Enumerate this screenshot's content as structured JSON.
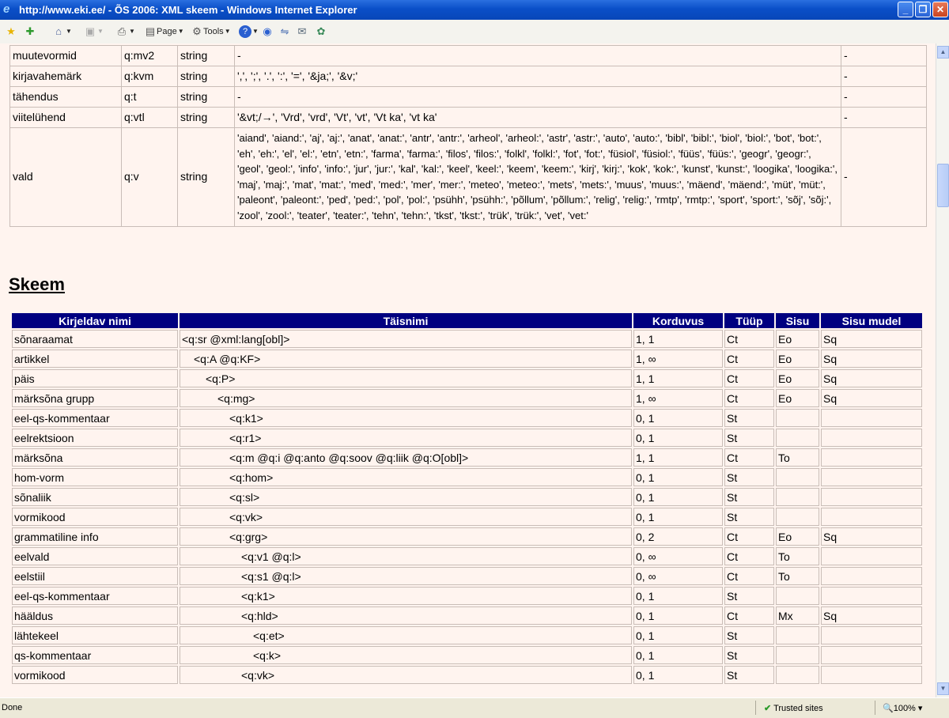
{
  "window": {
    "title": "http://www.eki.ee/ - ÕS 2006: XML skeem - Windows Internet Explorer",
    "minimize_icon": "minimize-icon",
    "maximize_icon": "restore-icon",
    "close_icon": "close-icon"
  },
  "toolbar": {
    "page_label": "Page",
    "tools_label": "Tools"
  },
  "attributes": [
    {
      "name": "muutevormid",
      "code": "q:mv2",
      "type": "string",
      "values": "-",
      "extra": "-"
    },
    {
      "name": "kirjavahemärk",
      "code": "q:kvm",
      "type": "string",
      "values": "',', ';', '.', ':', '=', '&ja;', '&v;'",
      "extra": "-"
    },
    {
      "name": "tähendus",
      "code": "q:t",
      "type": "string",
      "values": "-",
      "extra": "-"
    },
    {
      "name": "viitelühend",
      "code": "q:vtl",
      "type": "string",
      "values": "'&vt;/→', 'Vrd', 'vrd', 'Vt', 'vt', 'Vt ka', 'vt ka'",
      "extra": "-"
    },
    {
      "name": "vald",
      "code": "q:v",
      "type": "string",
      "values": "'aiand', 'aiand:', 'aj', 'aj:', 'anat', 'anat:', 'antr', 'antr:', 'arheol', 'arheol:', 'astr', 'astr:', 'auto', 'auto:', 'bibl', 'bibl:', 'biol', 'biol:', 'bot', 'bot:', 'eh', 'eh:', 'el', 'el:', 'etn', 'etn:', 'farma', 'farma:', 'filos', 'filos:', 'folkl', 'folkl:', 'fot', 'fot:', 'füsiol', 'füsiol:', 'füüs', 'füüs:', 'geogr', 'geogr:', 'geol', 'geol:', 'info', 'info:', 'jur', 'jur:', 'kal', 'kal:', 'keel', 'keel:', 'keem', 'keem:', 'kirj', 'kirj:', 'kok', 'kok:', 'kunst', 'kunst:', 'loogika', 'loogika:', 'maj', 'maj:', 'mat', 'mat:', 'med', 'med:', 'mer', 'mer:', 'meteo', 'meteo:', 'mets', 'mets:', 'muus', 'muus:', 'mäend', 'mäend:', 'müt', 'müt:', 'paleont', 'paleont:', 'ped', 'ped:', 'pol', 'pol:', 'psühh', 'psühh:', 'põllum', 'põllum:', 'relig', 'relig:', 'rmtp', 'rmtp:', 'sport', 'sport:', 'sõj', 'sõj:', 'zool', 'zool:', 'teater', 'teater:', 'tehn', 'tehn:', 'tkst', 'tkst:', 'trük', 'trük:', 'vet', 'vet:'",
      "extra": "-"
    }
  ],
  "section_title": "Skeem",
  "schema": {
    "headers": [
      "Kirjeldav nimi",
      "Täisnimi",
      "Korduvus",
      "Tüüp",
      "Sisu",
      "Sisu mudel"
    ],
    "rows": [
      {
        "name": "sõnaraamat",
        "full": "<q:sr @xml:lang[obl]>",
        "indent": 0,
        "rep": "1, 1",
        "type": "Ct",
        "content": "Eo",
        "model": "Sq"
      },
      {
        "name": "artikkel",
        "full": "<q:A @q:KF>",
        "indent": 1,
        "rep": "1, ∞",
        "type": "Ct",
        "content": "Eo",
        "model": "Sq"
      },
      {
        "name": "päis",
        "full": "<q:P>",
        "indent": 2,
        "rep": "1, 1",
        "type": "Ct",
        "content": "Eo",
        "model": "Sq"
      },
      {
        "name": "märksõna grupp",
        "full": "<q:mg>",
        "indent": 3,
        "rep": "1, ∞",
        "type": "Ct",
        "content": "Eo",
        "model": "Sq"
      },
      {
        "name": "eel-qs-kommentaar",
        "full": "<q:k1>",
        "indent": 4,
        "rep": "0, 1",
        "type": "St",
        "content": "",
        "model": ""
      },
      {
        "name": "eelrektsioon",
        "full": "<q:r1>",
        "indent": 4,
        "rep": "0, 1",
        "type": "St",
        "content": "",
        "model": ""
      },
      {
        "name": "märksõna",
        "full": "<q:m @q:i @q:anto @q:soov @q:liik @q:O[obl]>",
        "indent": 4,
        "rep": "1, 1",
        "type": "Ct",
        "content": "To",
        "model": ""
      },
      {
        "name": "hom-vorm",
        "full": "<q:hom>",
        "indent": 4,
        "rep": "0, 1",
        "type": "St",
        "content": "",
        "model": ""
      },
      {
        "name": "sõnaliik",
        "full": "<q:sl>",
        "indent": 4,
        "rep": "0, 1",
        "type": "St",
        "content": "",
        "model": ""
      },
      {
        "name": "vormikood",
        "full": "<q:vk>",
        "indent": 4,
        "rep": "0, 1",
        "type": "St",
        "content": "",
        "model": ""
      },
      {
        "name": "grammatiline info",
        "full": "<q:grg>",
        "indent": 4,
        "rep": "0, 2",
        "type": "Ct",
        "content": "Eo",
        "model": "Sq"
      },
      {
        "name": "eelvald",
        "full": "<q:v1 @q:l>",
        "indent": 5,
        "rep": "0, ∞",
        "type": "Ct",
        "content": "To",
        "model": ""
      },
      {
        "name": "eelstiil",
        "full": "<q:s1 @q:l>",
        "indent": 5,
        "rep": "0, ∞",
        "type": "Ct",
        "content": "To",
        "model": ""
      },
      {
        "name": "eel-qs-kommentaar",
        "full": "<q:k1>",
        "indent": 5,
        "rep": "0, 1",
        "type": "St",
        "content": "",
        "model": ""
      },
      {
        "name": "hääldus",
        "full": "<q:hld>",
        "indent": 5,
        "rep": "0, 1",
        "type": "Ct",
        "content": "Mx",
        "model": "Sq"
      },
      {
        "name": "lähtekeel",
        "full": "<q:et>",
        "indent": 6,
        "rep": "0, 1",
        "type": "St",
        "content": "",
        "model": ""
      },
      {
        "name": "qs-kommentaar",
        "full": "<q:k>",
        "indent": 6,
        "rep": "0, 1",
        "type": "St",
        "content": "",
        "model": ""
      },
      {
        "name": "vormikood",
        "full": "<q:vk>",
        "indent": 5,
        "rep": "0, 1",
        "type": "St",
        "content": "",
        "model": ""
      }
    ]
  },
  "status": {
    "left": "Done",
    "zone": "Trusted sites",
    "zoom": "100%"
  }
}
